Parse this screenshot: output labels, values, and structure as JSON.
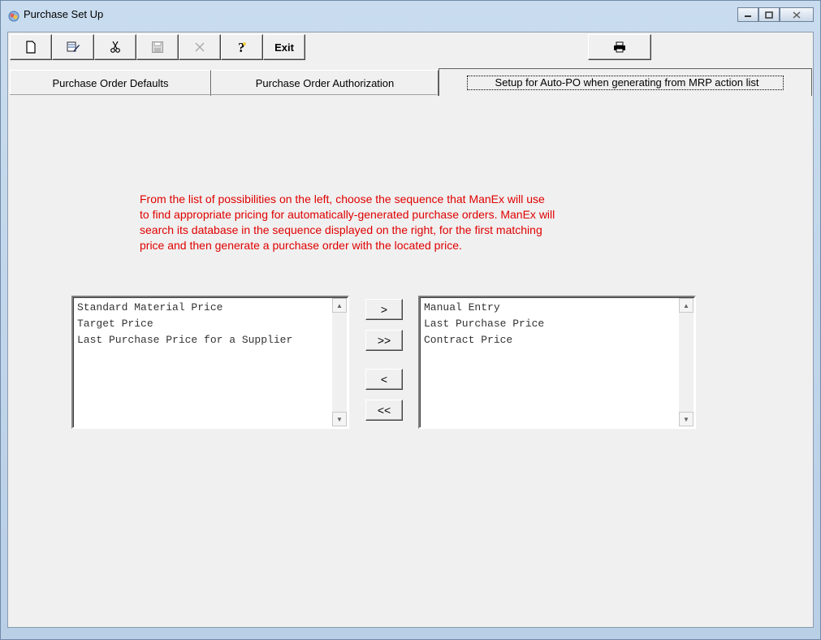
{
  "window": {
    "title": "Purchase Set Up"
  },
  "toolbar": {
    "new_icon": "new-document-icon",
    "edit_icon": "edit-icon",
    "cut_icon": "scissors-icon",
    "save_icon": "save-icon",
    "delete_icon": "delete-x-icon",
    "help_icon": "help-question-icon",
    "exit_label": "Exit",
    "print_icon": "printer-icon"
  },
  "tabs": [
    {
      "label": "Purchase Order Defaults"
    },
    {
      "label": "Purchase Order Authorization"
    },
    {
      "label": "Setup for Auto-PO when generating from MRP action list"
    }
  ],
  "instructions": {
    "line1": "From the list of possibilities on the left, choose the sequence that ManEx will use",
    "line2": "to find appropriate pricing for automatically-generated purchase orders. ManEx will",
    "line3": "search its database in the sequence displayed on the right, for the first matching",
    "line4": "price and then generate a purchase order with the located price."
  },
  "available_list": [
    "Standard Material Price",
    "Target Price",
    "Last Purchase Price for a Supplier"
  ],
  "selected_list": [
    "Manual Entry",
    "Last Purchase Price",
    "Contract Price"
  ],
  "move_buttons": {
    "add_one": ">",
    "add_all": ">>",
    "remove_one": "<",
    "remove_all": "<<"
  },
  "colors": {
    "instruction_text": "#e00000",
    "panel": "#f0f0f0",
    "frame": "#b9cfe6"
  }
}
